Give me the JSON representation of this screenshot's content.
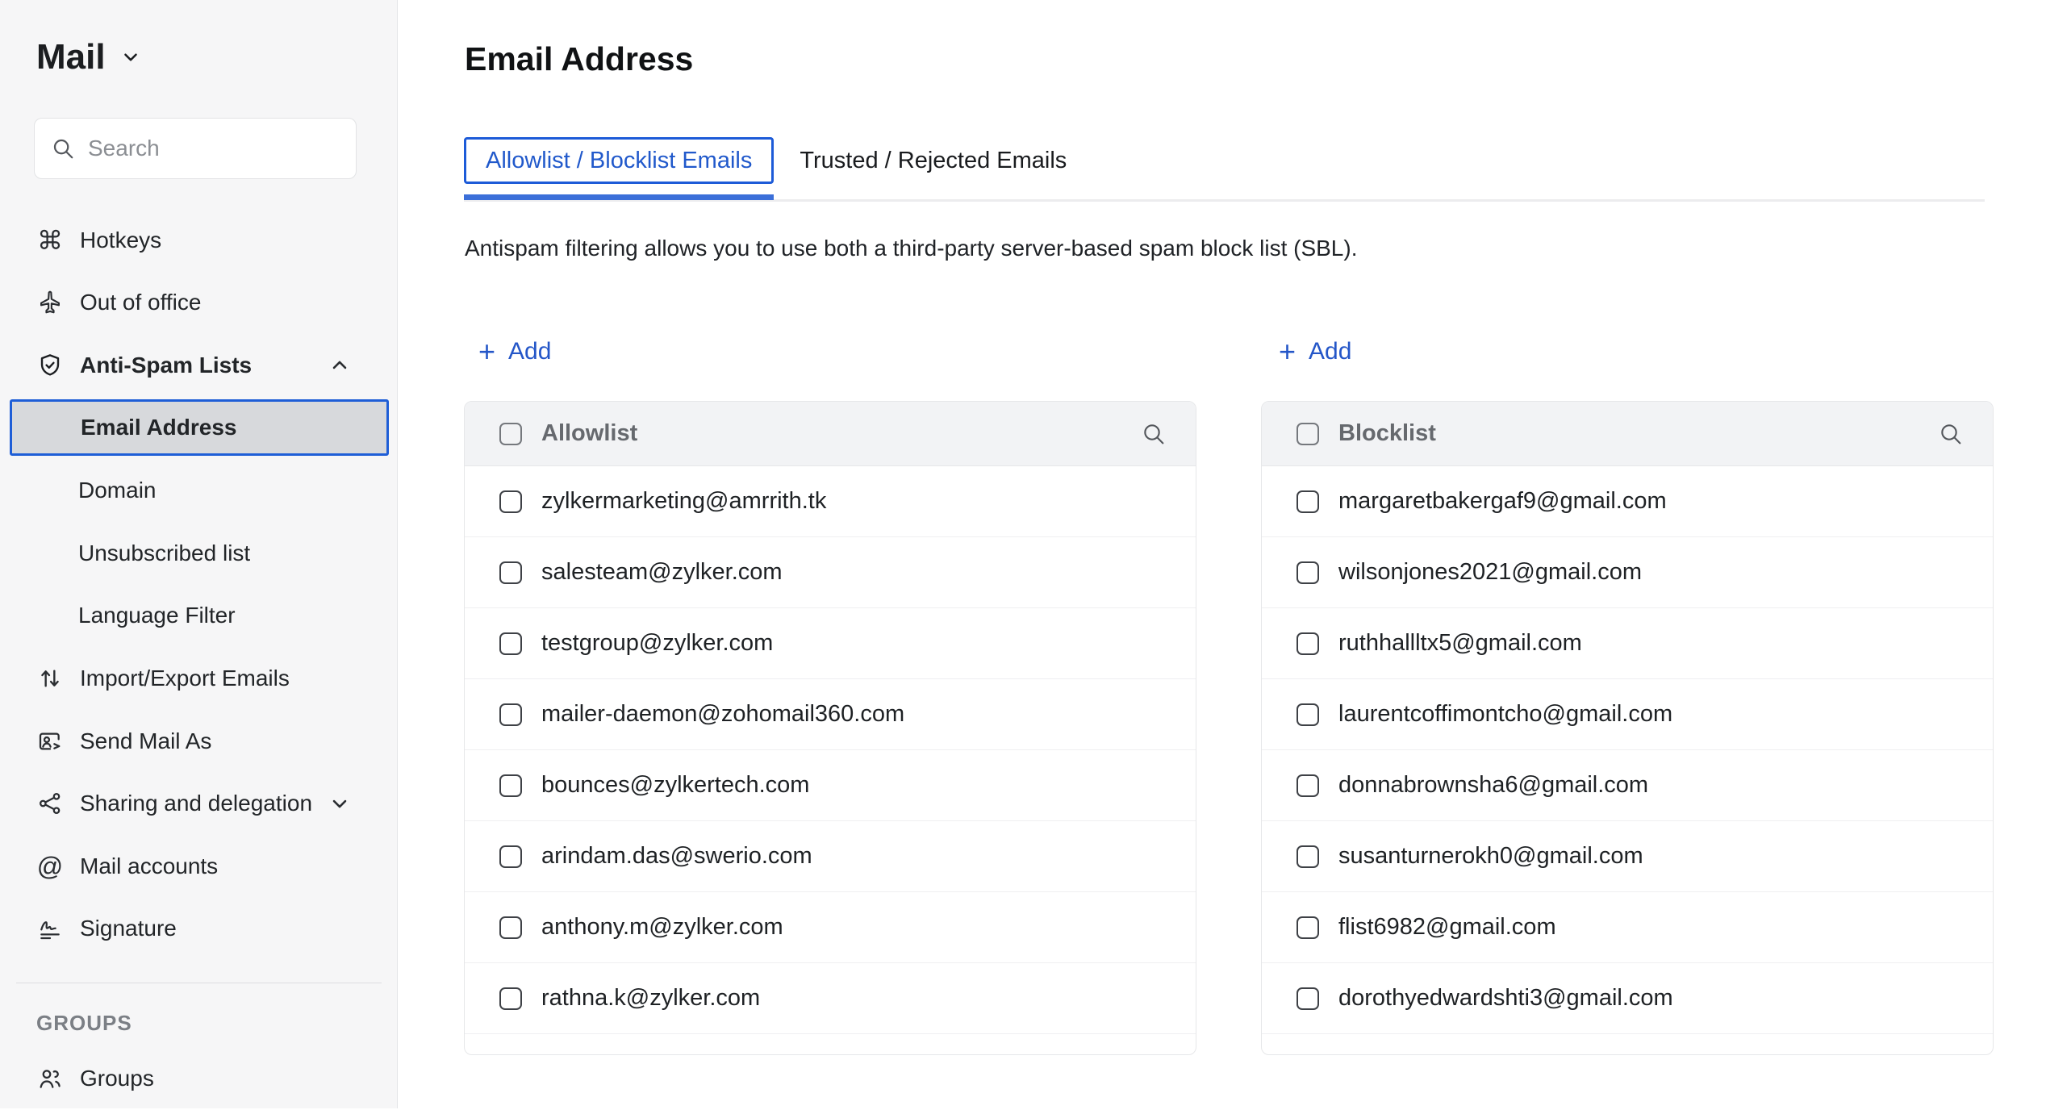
{
  "colors": {
    "accent_blue_text": "#2159cb",
    "accent_blue_border": "#1d5bd8",
    "accent_blue_underline": "#3b6fd9",
    "sidebar_bg": "#f6f6f7",
    "selected_item_bg": "#d7d9dc",
    "panel_header_bg": "#f2f3f5",
    "muted_text": "#66696e"
  },
  "icons": {
    "command": "⌘",
    "at": "@",
    "plus": "+"
  },
  "sidebar": {
    "app_title": "Mail",
    "search_placeholder": "Search",
    "items": [
      {
        "label": "Hotkeys"
      },
      {
        "label": "Out of office"
      },
      {
        "label": "Anti-Spam Lists"
      },
      {
        "label": "Email Address",
        "selected": true
      },
      {
        "label": "Domain"
      },
      {
        "label": "Unsubscribed list"
      },
      {
        "label": "Language Filter"
      },
      {
        "label": "Import/Export Emails"
      },
      {
        "label": "Send Mail As"
      },
      {
        "label": "Sharing and delegation"
      },
      {
        "label": "Mail accounts"
      },
      {
        "label": "Signature"
      }
    ],
    "groups_section_label": "GROUPS",
    "groups_item_label": "Groups"
  },
  "main": {
    "page_title": "Email Address",
    "tabs": [
      {
        "label": "Allowlist / Blocklist Emails",
        "active": true
      },
      {
        "label": "Trusted / Rejected Emails",
        "active": false
      }
    ],
    "description": "Antispam filtering allows you to use both a third-party server-based spam block list (SBL).",
    "allowlist": {
      "add_label": "Add",
      "title": "Allowlist",
      "items": [
        "zylkermarketing@amrrith.tk",
        "salesteam@zylker.com",
        "testgroup@zylker.com",
        "mailer-daemon@zohomail360.com",
        "bounces@zylkertech.com",
        "arindam.das@swerio.com",
        "anthony.m@zylker.com",
        "rathna.k@zylker.com"
      ]
    },
    "blocklist": {
      "add_label": "Add",
      "title": "Blocklist",
      "items": [
        "margaretbakergaf9@gmail.com",
        "wilsonjones2021@gmail.com",
        "ruthhallltx5@gmail.com",
        "laurentcoffimontcho@gmail.com",
        "donnabrownsha6@gmail.com",
        "susanturnerokh0@gmail.com",
        "flist6982@gmail.com",
        "dorothyedwardshti3@gmail.com"
      ]
    }
  }
}
